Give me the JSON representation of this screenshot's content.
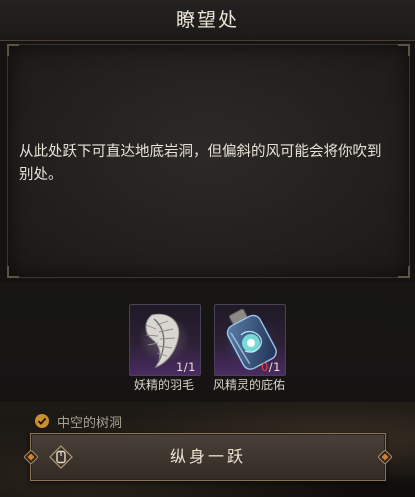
{
  "dialog": {
    "title": "瞭望处",
    "description": "从此处跃下可直达地底岩洞，但偏斜的风可能会将你吹到别处。"
  },
  "items": [
    {
      "name": "妖精的羽毛",
      "have": "1",
      "need": "1",
      "icon": "feather-icon"
    },
    {
      "name": "风精灵的庇佑",
      "have": "0",
      "need": "1",
      "icon": "spirit-bottle-icon"
    }
  ],
  "location": {
    "label": "中空的树洞",
    "status_icon": "check-icon"
  },
  "action": {
    "label": "纵身一跃",
    "key_icon": "key-prompt-icon"
  },
  "colors": {
    "accent": "#c8902e",
    "insufficient": "#e0484a",
    "rare_item": "#4a2b63",
    "button_border": "#8a7257"
  }
}
